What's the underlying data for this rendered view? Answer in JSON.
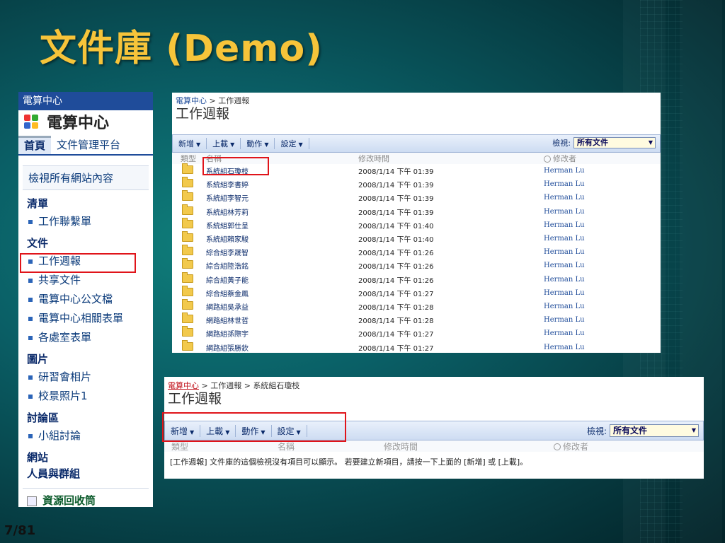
{
  "slide": {
    "title": "文件庫 (Demo)",
    "number": "7/81"
  },
  "nav": {
    "site_bar": "電算中心",
    "site_title": "電算中心",
    "tabs": [
      {
        "label": "首頁"
      },
      {
        "label": "文件管理平台"
      }
    ],
    "view_all": "檢視所有網站內容",
    "sections": [
      {
        "heading": "清單",
        "items": [
          "工作聯繫單"
        ]
      },
      {
        "heading": "文件",
        "items": [
          "工作週報",
          "共享文件",
          "電算中心公文檔",
          "電算中心相關表單",
          "各處室表單"
        ]
      },
      {
        "heading": "圖片",
        "items": [
          "研習會相片",
          "校景照片1"
        ]
      },
      {
        "heading": "討論區",
        "items": [
          "小組討論"
        ]
      }
    ],
    "sites_heading": "網站",
    "people_heading": "人員與群組",
    "recycle": "資源回收筒"
  },
  "panel1": {
    "breadcrumb_root": "電算中心",
    "breadcrumb_current": "工作週報",
    "list_title": "工作週報",
    "toolbar": {
      "new": "新增",
      "upload": "上載",
      "actions": "動作",
      "settings": "設定"
    },
    "view_label": "檢視:",
    "view_value": "所有文件",
    "columns": {
      "type": "類型",
      "name": "名稱",
      "modified": "修改時間",
      "modified_by": "修改者"
    },
    "rows": [
      {
        "name": "系統組石瓊枝",
        "modified": "2008/1/14 下午 01:39",
        "by": "Herman Lu"
      },
      {
        "name": "系統組李書婷",
        "modified": "2008/1/14 下午 01:39",
        "by": "Herman Lu"
      },
      {
        "name": "系統組李智元",
        "modified": "2008/1/14 下午 01:39",
        "by": "Herman Lu"
      },
      {
        "name": "系統組林芳莉",
        "modified": "2008/1/14 下午 01:39",
        "by": "Herman Lu"
      },
      {
        "name": "系統組郭仕呈",
        "modified": "2008/1/14 下午 01:40",
        "by": "Herman Lu"
      },
      {
        "name": "系統組賴家駿",
        "modified": "2008/1/14 下午 01:40",
        "by": "Herman Lu"
      },
      {
        "name": "綜合組李晟智",
        "modified": "2008/1/14 下午 01:26",
        "by": "Herman Lu"
      },
      {
        "name": "綜合組陸浩銘",
        "modified": "2008/1/14 下午 01:26",
        "by": "Herman Lu"
      },
      {
        "name": "綜合組黃子能",
        "modified": "2008/1/14 下午 01:26",
        "by": "Herman Lu"
      },
      {
        "name": "綜合組蔡金鳳",
        "modified": "2008/1/14 下午 01:27",
        "by": "Herman Lu"
      },
      {
        "name": "網路組吳承益",
        "modified": "2008/1/14 下午 01:28",
        "by": "Herman Lu"
      },
      {
        "name": "網路組林世哲",
        "modified": "2008/1/14 下午 01:28",
        "by": "Herman Lu"
      },
      {
        "name": "網路組孫際宇",
        "modified": "2008/1/14 下午 01:27",
        "by": "Herman Lu"
      },
      {
        "name": "網路組張勝欽",
        "modified": "2008/1/14 下午 01:27",
        "by": "Herman Lu"
      }
    ]
  },
  "panel2": {
    "breadcrumb_root": "電算中心",
    "breadcrumb_mid": "工作週報",
    "breadcrumb_current": "系統組石瓊枝",
    "list_title": "工作週報",
    "toolbar": {
      "new": "新增",
      "upload": "上載",
      "actions": "動作",
      "settings": "設定"
    },
    "view_label": "檢視:",
    "view_value": "所有文件",
    "columns": {
      "type": "類型",
      "name": "名稱",
      "modified": "修改時間",
      "modified_by": "修改者"
    },
    "empty_message": "[工作週報] 文件庫的這個檢視沒有項目可以顯示。 若要建立新項目，請按一下上面的 [新增] 或 [上載]。"
  },
  "colors": {
    "title": "#f6c43a",
    "highlight": "#e0141a",
    "nav_bar": "#1f4c9a"
  }
}
